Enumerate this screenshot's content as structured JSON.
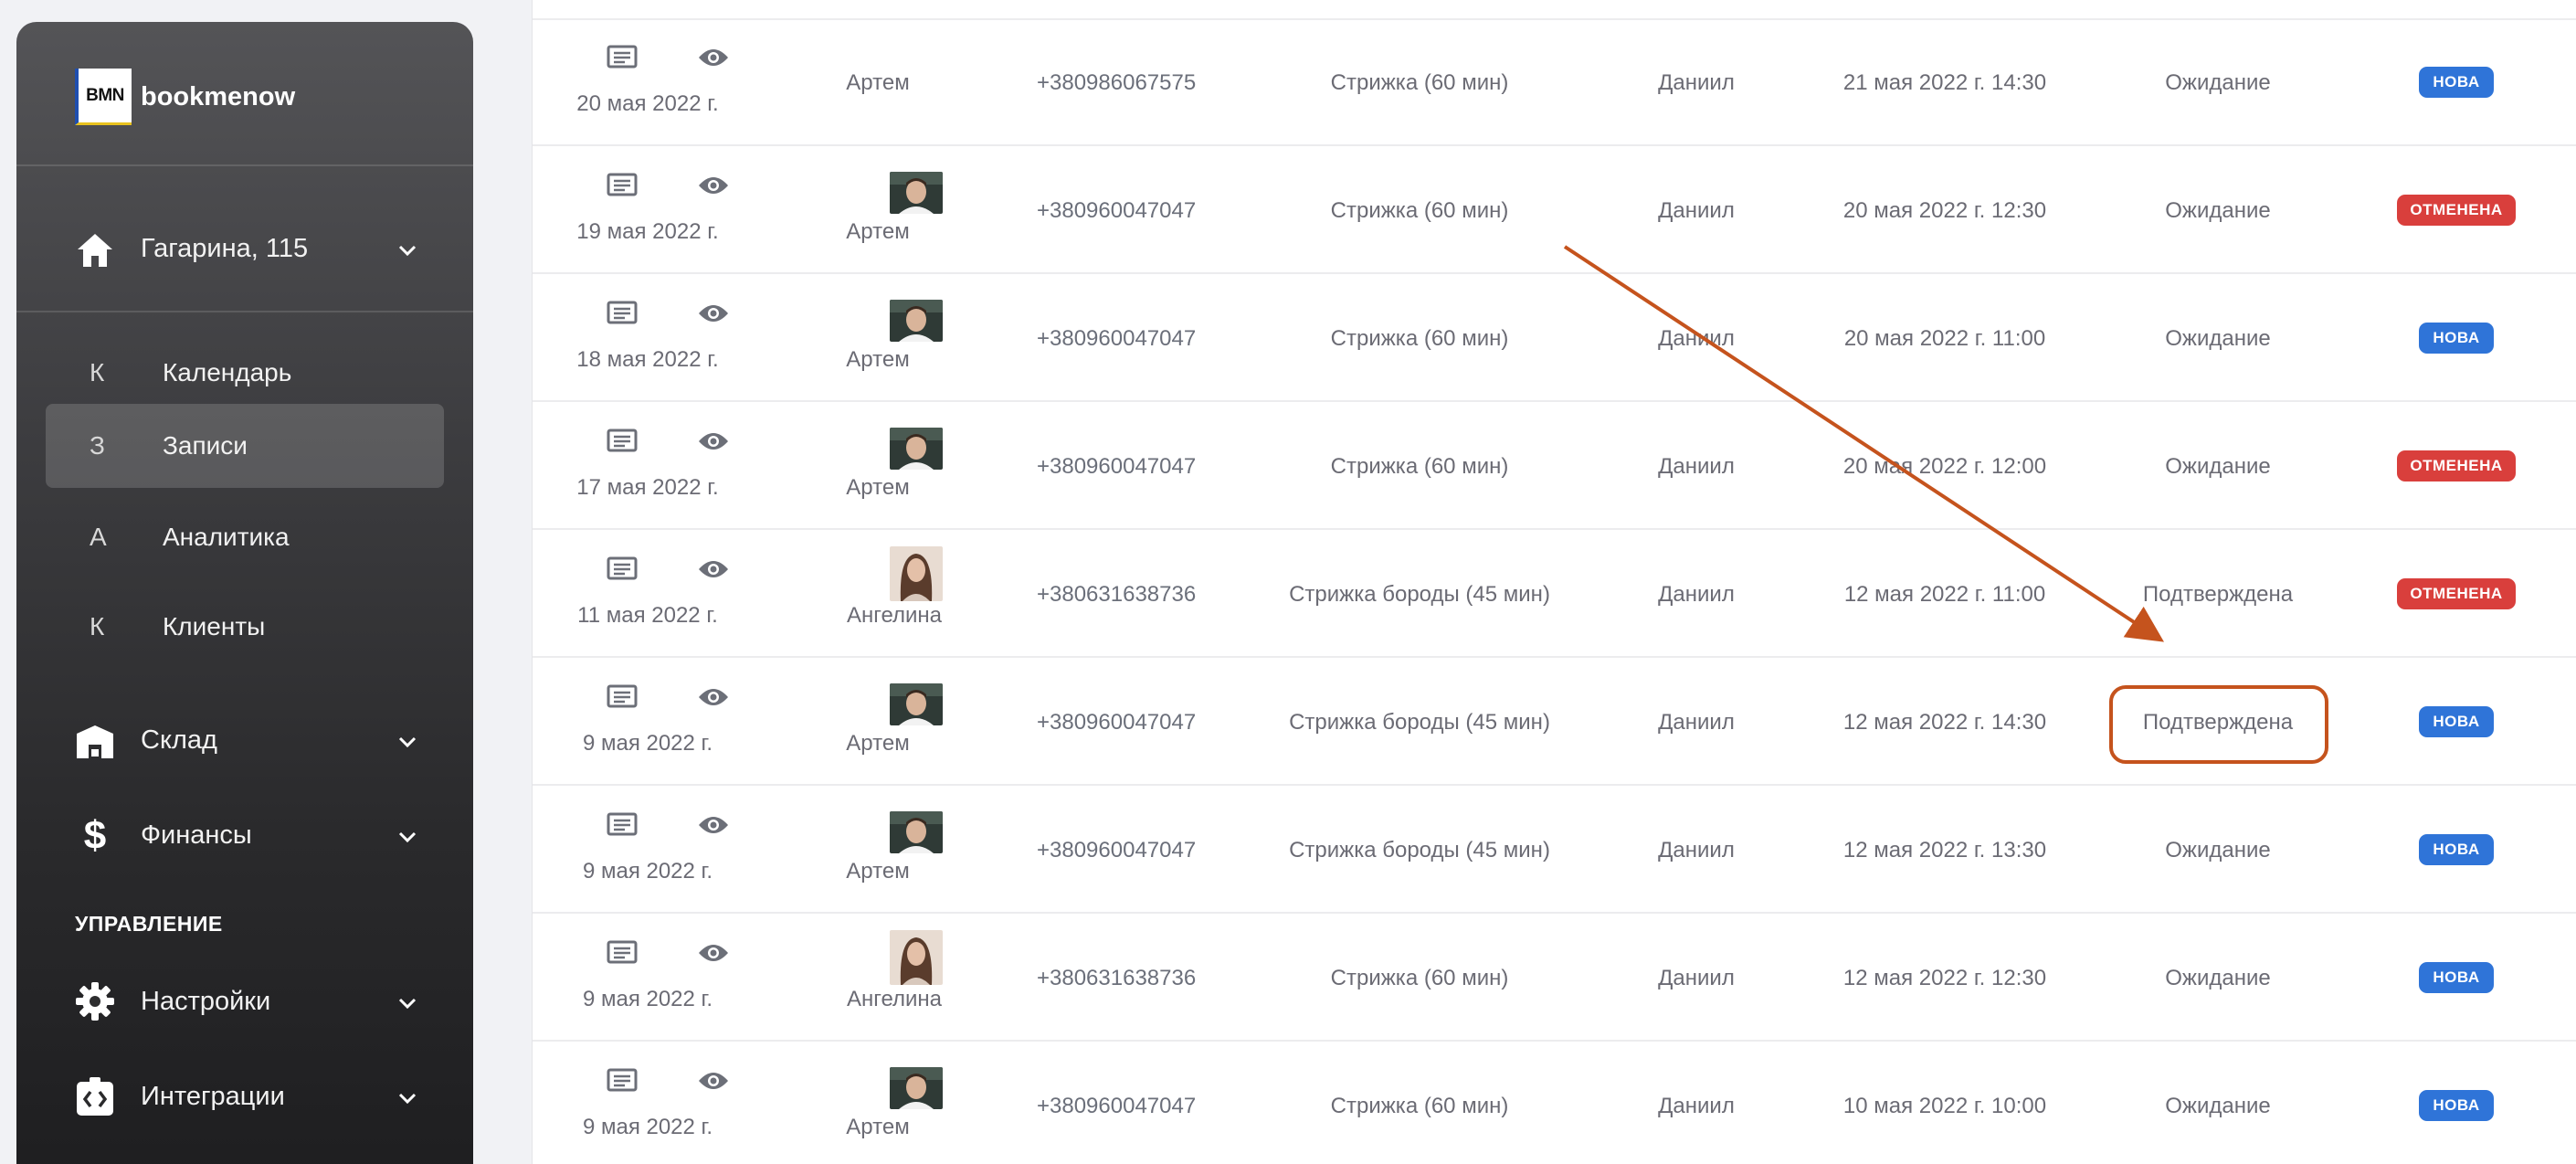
{
  "brand": {
    "logo_text": "BMN",
    "name": "bookmenow"
  },
  "sidebar": {
    "location": "Гагарина, 115",
    "sub_items": [
      {
        "letter": "К",
        "label": "Календарь"
      },
      {
        "letter": "З",
        "label": "Записи"
      },
      {
        "letter": "А",
        "label": "Аналитика"
      },
      {
        "letter": "К",
        "label": "Клиенты"
      }
    ],
    "warehouse": "Склад",
    "finance": "Финансы",
    "section_title": "УПРАВЛЕНИЕ",
    "settings": "Настройки",
    "integrations": "Интеграции",
    "active_item": "Записи"
  },
  "colors": {
    "badge_new": "#2f74d8",
    "badge_cancelled": "#d93f3c",
    "annotation": "#c5531d"
  },
  "icons": {
    "comment": "comment-icon",
    "view": "eye-icon"
  },
  "bookings": [
    {
      "date": "20 мая 2022 г.",
      "client": "Артем",
      "avatar": "none",
      "phone": "+380986067575",
      "service": "Стрижка (60 мин)",
      "master": "Даниил",
      "visit_time": "21 мая 2022 г. 14:30",
      "status": "Ожидание",
      "badge": "НОВА",
      "badge_type": "new"
    },
    {
      "date": "19 мая 2022 г.",
      "client": "Артем",
      "avatar": "male",
      "phone": "+380960047047",
      "service": "Стрижка (60 мин)",
      "master": "Даниил",
      "visit_time": "20 мая 2022 г. 12:30",
      "status": "Ожидание",
      "badge": "ОТМЕНЕНА",
      "badge_type": "cancelled"
    },
    {
      "date": "18 мая 2022 г.",
      "client": "Артем",
      "avatar": "male",
      "phone": "+380960047047",
      "service": "Стрижка (60 мин)",
      "master": "Даниил",
      "visit_time": "20 мая 2022 г. 11:00",
      "status": "Ожидание",
      "badge": "НОВА",
      "badge_type": "new"
    },
    {
      "date": "17 мая 2022 г.",
      "client": "Артем",
      "avatar": "male",
      "phone": "+380960047047",
      "service": "Стрижка (60 мин)",
      "master": "Даниил",
      "visit_time": "20 мая 2022 г. 12:00",
      "status": "Ожидание",
      "badge": "ОТМЕНЕНА",
      "badge_type": "cancelled"
    },
    {
      "date": "11 мая 2022 г.",
      "client": "Ангелина",
      "avatar": "female",
      "phone": "+380631638736",
      "service": "Стрижка бороды (45 мин)",
      "master": "Даниил",
      "visit_time": "12 мая 2022 г. 11:00",
      "status": "Подтверждена",
      "badge": "ОТМЕНЕНА",
      "badge_type": "cancelled"
    },
    {
      "date": "9 мая 2022 г.",
      "client": "Артем",
      "avatar": "male",
      "phone": "+380960047047",
      "service": "Стрижка бороды (45 мин)",
      "master": "Даниил",
      "visit_time": "12 мая 2022 г. 14:30",
      "status": "Подтверждена",
      "badge": "НОВА",
      "badge_type": "new"
    },
    {
      "date": "9 мая 2022 г.",
      "client": "Артем",
      "avatar": "male",
      "phone": "+380960047047",
      "service": "Стрижка бороды (45 мин)",
      "master": "Даниил",
      "visit_time": "12 мая 2022 г. 13:30",
      "status": "Ожидание",
      "badge": "НОВА",
      "badge_type": "new"
    },
    {
      "date": "9 мая 2022 г.",
      "client": "Ангелина",
      "avatar": "female",
      "phone": "+380631638736",
      "service": "Стрижка (60 мин)",
      "master": "Даниил",
      "visit_time": "12 мая 2022 г. 12:30",
      "status": "Ожидание",
      "badge": "НОВА",
      "badge_type": "new"
    },
    {
      "date": "9 мая 2022 г.",
      "client": "Артем",
      "avatar": "male",
      "phone": "+380960047047",
      "service": "Стрижка (60 мин)",
      "master": "Даниил",
      "visit_time": "10 мая 2022 г. 10:00",
      "status": "Ожидание",
      "badge": "НОВА",
      "badge_type": "new"
    }
  ]
}
